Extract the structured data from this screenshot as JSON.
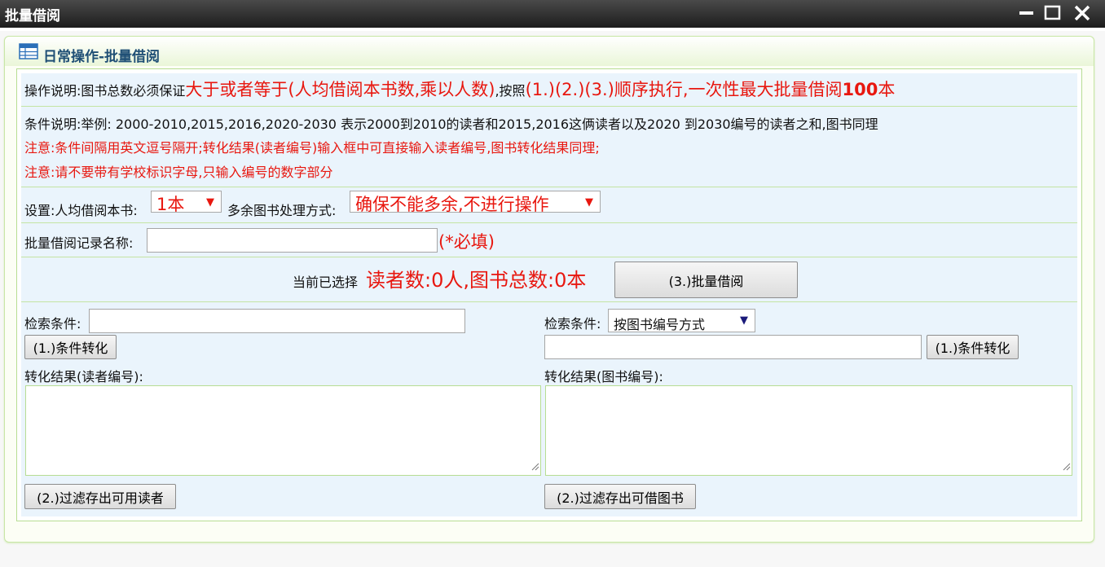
{
  "window": {
    "title": "批量借阅",
    "minimize_icon": "minimize-icon",
    "maximize_icon": "maximize-icon",
    "close_icon": "close-icon"
  },
  "panel": {
    "icon": "table-icon",
    "title": "日常操作-批量借阅"
  },
  "instructions": {
    "op_prefix": "操作说明:图书总数必须保证",
    "op_red1": "大于或者等于(人均借阅本书数,乘以人数)",
    "op_mid": ",按照",
    "op_red2": "(1.)(2.)(3.)顺序执行,一次性最大批量借阅",
    "op_bold": "100",
    "op_red3": "本",
    "cond_line": "条件说明:举例: 2000-2010,2015,2016,2020-2030  表示2000到2010的读者和2015,2016这俩读者以及2020 到2030编号的读者之和,图书同理",
    "note1": "注意:条件间隔用英文逗号隔开;转化结果(读者编号)输入框中可直接输入读者编号,图书转化结果同理;",
    "note2": "注意:请不要带有学校标识字母,只输入编号的数字部分"
  },
  "settings": {
    "per_person_label": "设置:人均借阅本书:",
    "per_person_value": "1本",
    "surplus_label": "多余图书处理方式:",
    "surplus_value": "确保不能多余,不进行操作"
  },
  "record": {
    "name_label": "批量借阅记录名称:",
    "name_value": "",
    "required_note": "(*必填)"
  },
  "summary": {
    "prefix": "当前已选择",
    "text": "读者数:0人,图书总数:0本",
    "batch_button": "(3.)批量借阅"
  },
  "reader": {
    "search_label": "检索条件:",
    "search_value": "",
    "convert_button": "(1.)条件转化",
    "result_label": "转化结果(读者编号):",
    "result_value": "",
    "filter_button": "(2.)过滤存出可用读者"
  },
  "book": {
    "search_label": "检索条件:",
    "search_mode": "按图书编号方式",
    "search_value": "",
    "convert_button": "(1.)条件转化",
    "result_label": "转化结果(图书编号):",
    "result_value": "",
    "filter_button": "(2.)过滤存出可借图书"
  },
  "colors": {
    "accent_red": "#e8170f",
    "panel_title": "#1f4f75",
    "border_green": "#b7dd93",
    "row_bg": "#eaf4fc"
  }
}
